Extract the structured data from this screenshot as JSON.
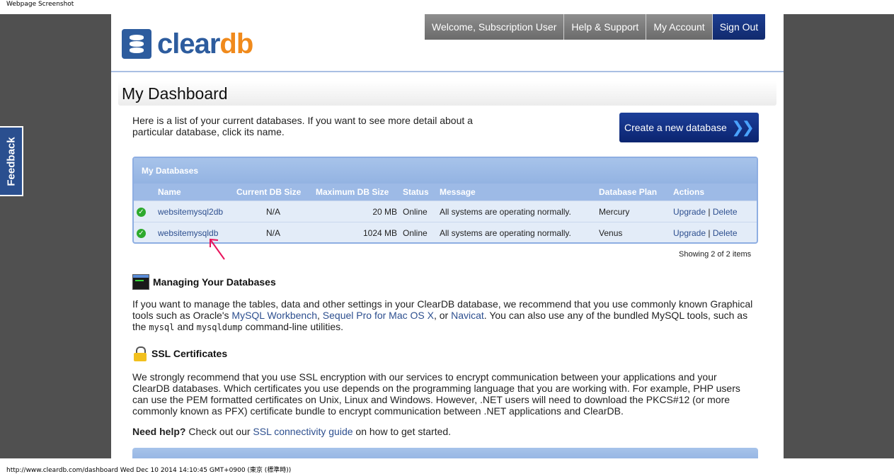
{
  "browser": {
    "top_caption": "Webpage Screenshot",
    "status_line": "http://www.cleardb.com/dashboard Wed Dec 10 2014 14:10:45 GMT+0900 (東京 (標準時))"
  },
  "feedback_label": "Feedback",
  "logo": {
    "part1": "clear",
    "part2": "db"
  },
  "nav": {
    "welcome": "Welcome, Subscription User",
    "help": "Help & Support",
    "account": "My Account",
    "signout": "Sign Out"
  },
  "page_title": "My Dashboard",
  "intro_text": "Here is a list of your current databases. If you want to see more detail about a particular database, click its name.",
  "create_button": "Create a new database",
  "databases": {
    "title": "My Databases",
    "columns": [
      "Name",
      "Current DB Size",
      "Maximum DB Size",
      "Status",
      "Message",
      "Database Plan",
      "Actions"
    ],
    "rows": [
      {
        "name": "websitemysql2db",
        "current": "N/A",
        "max": "20 MB",
        "status": "Online",
        "message": "All systems are operating normally.",
        "plan": "Mercury",
        "upgrade": "Upgrade",
        "sep": "|",
        "delete": "Delete"
      },
      {
        "name": "websitemysqldb",
        "current": "N/A",
        "max": "1024 MB",
        "status": "Online",
        "message": "All systems are operating normally.",
        "plan": "Venus",
        "upgrade": "Upgrade",
        "sep": "|",
        "delete": "Delete"
      }
    ],
    "showing": "Showing 2 of 2 items"
  },
  "managing": {
    "heading": "Managing Your Databases",
    "p1": "If you want to manage the tables, data and other settings in your ClearDB database, we recommend that you use commonly known Graphical tools such as Oracle's ",
    "link_workbench": "MySQL Workbench",
    "comma": ", ",
    "link_sequel": "Sequel Pro for Mac OS X",
    "or": ", or ",
    "link_navicat": "Navicat",
    "p2": ". You can also use any of the bundled MySQL tools, such as the ",
    "mysql": "mysql",
    "and": " and ",
    "mysqldump": "mysqldump",
    "p3": " command-line utilities."
  },
  "ssl": {
    "heading": "SSL Certificates",
    "para": "We strongly recommend that you use SSL encryption with our services to encrypt communication between your applications and your ClearDB databases. Which certificates you use depends on the programming language that you are working with. For example, PHP users can use the PEM formatted certificates on Unix, Linux and Windows. However, .NET users will need to download the PKCS#12 (or more commonly known as PFX) certificate bundle to encrypt communication between .NET applications and ClearDB.",
    "help_bold": "Need help?",
    "help_text": " Check out our ",
    "help_link": "SSL connectivity guide",
    "help_end": " on how to get started."
  },
  "colors": {
    "brand_blue": "#2d5c9e",
    "brand_orange": "#f08a1c",
    "side_gray": "#505050",
    "button_navy": "#112a6e",
    "table_blue": "#9dbae6"
  }
}
